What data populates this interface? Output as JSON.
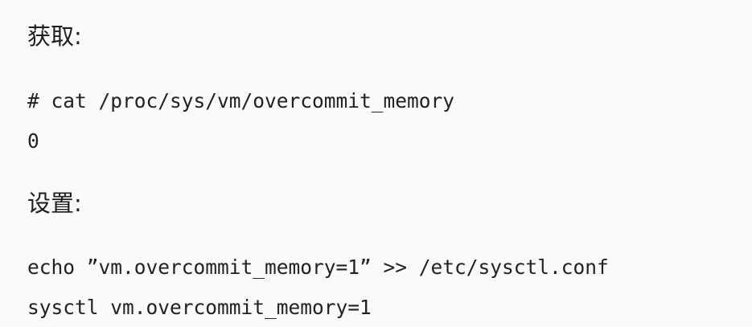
{
  "sections": {
    "get": {
      "heading": "获取:",
      "command": "# cat /proc/sys/vm/overcommit_memory",
      "output": "0"
    },
    "set": {
      "heading": "设置:",
      "line1": "echo ”vm.overcommit_memory=1” >> /etc/sysctl.conf",
      "line2": "sysctl vm.overcommit_memory=1"
    }
  }
}
